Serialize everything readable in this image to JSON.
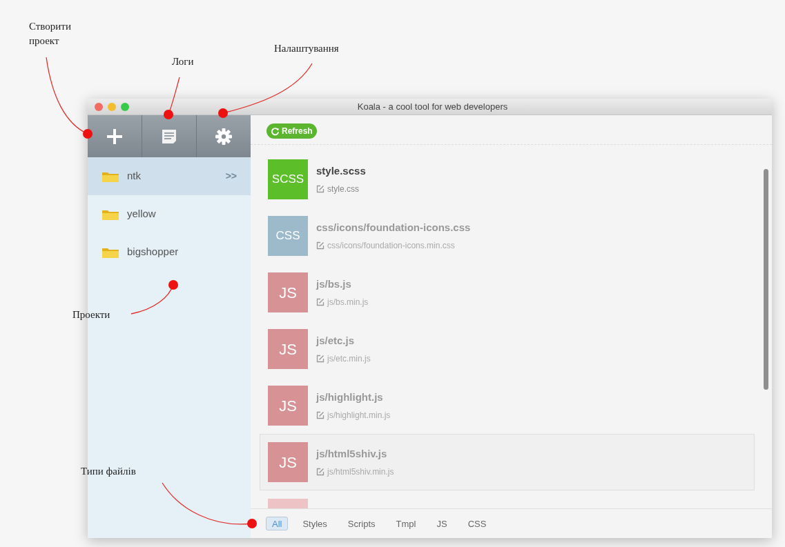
{
  "annotations": [
    {
      "label": "Створити\nпроект"
    },
    {
      "label": "Логи"
    },
    {
      "label": "Налаштування"
    },
    {
      "label": "Проекти"
    },
    {
      "label": "Типи файлів"
    }
  ],
  "window": {
    "title": "Koala - a cool tool for web developers"
  },
  "sidebar": {
    "items": [
      {
        "name": "ntk",
        "selected": true,
        "arrow": ">>"
      },
      {
        "name": "yellow",
        "selected": false
      },
      {
        "name": "bigshopper",
        "selected": false
      }
    ]
  },
  "refresh_button": "Refresh",
  "files": [
    {
      "kind": "scss",
      "tile": "SCSS",
      "name": "style.scss",
      "output": "style.css",
      "enabled": true,
      "highlighted": false
    },
    {
      "kind": "css",
      "tile": "CSS",
      "name": "css/icons/foundation-icons.css",
      "output": "css/icons/foundation-icons.min.css",
      "enabled": false,
      "highlighted": false
    },
    {
      "kind": "js",
      "tile": "JS",
      "name": "js/bs.js",
      "output": "js/bs.min.js",
      "enabled": false,
      "highlighted": false
    },
    {
      "kind": "js",
      "tile": "JS",
      "name": "js/etc.js",
      "output": "js/etc.min.js",
      "enabled": false,
      "highlighted": false
    },
    {
      "kind": "js",
      "tile": "JS",
      "name": "js/highlight.js",
      "output": "js/highlight.min.js",
      "enabled": false,
      "highlighted": false
    },
    {
      "kind": "js",
      "tile": "JS",
      "name": "js/html5shiv.js",
      "output": "js/html5shiv.min.js",
      "enabled": false,
      "highlighted": true
    }
  ],
  "filters": [
    {
      "label": "All",
      "selected": true
    },
    {
      "label": "Styles",
      "selected": false
    },
    {
      "label": "Scripts",
      "selected": false
    },
    {
      "label": "Tmpl",
      "selected": false
    },
    {
      "label": "JS",
      "selected": false
    },
    {
      "label": "CSS",
      "selected": false
    }
  ]
}
